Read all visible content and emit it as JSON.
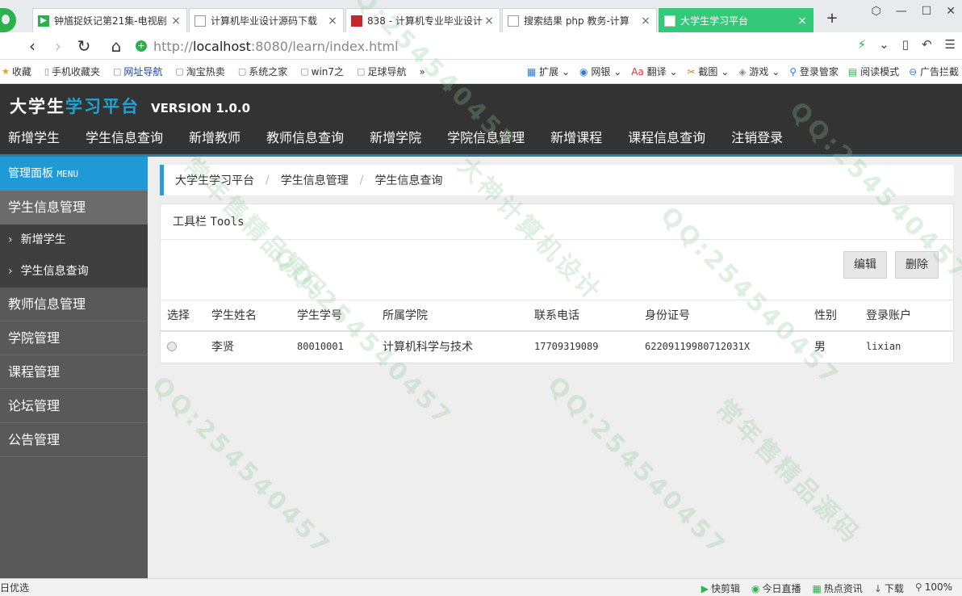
{
  "browser": {
    "tabs": [
      {
        "title": "钟馗捉妖记第21集-电视剧",
        "icon": "video-site-icon"
      },
      {
        "title": "计算机毕业设计源码下载",
        "icon": "page-icon"
      },
      {
        "title": "838 - 计算机专业毕业设计",
        "icon": "red-site-icon"
      },
      {
        "title": "搜索结果 php 教务-计算",
        "icon": "page-icon"
      },
      {
        "title": "大学生学习平台",
        "icon": "app-icon"
      }
    ],
    "new_tab": "+",
    "url_host": "http://",
    "url_bold": "localhost",
    "url_rest": ":8080/learn/index.html",
    "bookmarks": [
      "收藏",
      "手机收藏夹",
      "网址导航",
      "淘宝热卖",
      "系统之家",
      "win7之",
      "足球导航"
    ],
    "bookmarks_more": "»",
    "tools": [
      "扩展",
      "网银",
      "翻译",
      "截图",
      "游戏",
      "登录管家",
      "阅读模式",
      "广告拦截"
    ]
  },
  "app": {
    "logo_main": "大学生",
    "logo_accent": "学习平台",
    "version": "VERSION 1.0.0",
    "nav": [
      "新增学生",
      "学生信息查询",
      "新增教师",
      "教师信息查询",
      "新增学院",
      "学院信息管理",
      "新增课程",
      "课程信息查询",
      "注销登录"
    ]
  },
  "sidebar": {
    "panel_title": "管理面板",
    "panel_title_en": "MENU",
    "groups": [
      {
        "label": "学生信息管理",
        "sub": [
          "新增学生",
          "学生信息查询"
        ]
      },
      {
        "label": "教师信息管理"
      },
      {
        "label": "学院管理"
      },
      {
        "label": "课程管理"
      },
      {
        "label": "论坛管理"
      },
      {
        "label": "公告管理"
      }
    ]
  },
  "main": {
    "breadcrumb": [
      "大学生学习平台",
      "学生信息管理",
      "学生信息查询"
    ],
    "breadcrumb_sep": "/",
    "toolbar_title": "工具栏",
    "toolbar_title_en": "Tools",
    "edit_label": "编辑",
    "delete_label": "删除",
    "table": {
      "columns": [
        "选择",
        "学生姓名",
        "学生学号",
        "所属学院",
        "联系电话",
        "身份证号",
        "性别",
        "登录账户"
      ],
      "rows": [
        [
          "",
          "李贤",
          "80010001",
          "计算机科学与技术",
          "17709319089",
          "62209119980712031X",
          "男",
          "lixian"
        ]
      ]
    }
  },
  "statusbar": {
    "left": "日优选",
    "items": [
      "快剪辑",
      "今日直播",
      "热点资讯",
      "下载",
      "100%"
    ]
  },
  "watermarks": [
    "QQ:254540457",
    "大神计算机设计",
    "常年售精品源码"
  ]
}
